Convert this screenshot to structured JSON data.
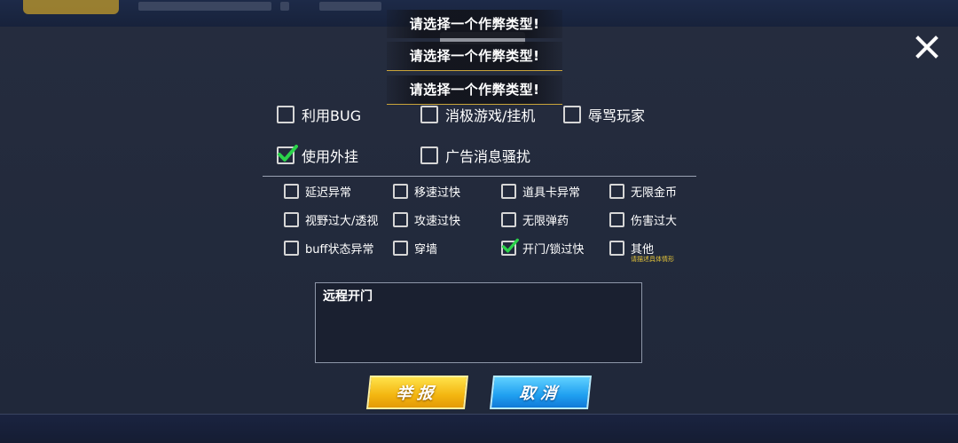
{
  "toasts": [
    "请选择一个作弊类型!",
    "请选择一个作弊类型!",
    "请选择一个作弊类型!"
  ],
  "main_options": [
    {
      "label": "利用BUG",
      "checked": false
    },
    {
      "label": "消极游戏/挂机",
      "checked": false
    },
    {
      "label": "辱骂玩家",
      "checked": false
    },
    {
      "label": "使用外挂",
      "checked": true
    },
    {
      "label": "广告消息骚扰",
      "checked": false
    }
  ],
  "sub_options": [
    {
      "label": "延迟异常",
      "checked": false
    },
    {
      "label": "移速过快",
      "checked": false
    },
    {
      "label": "道具卡异常",
      "checked": false
    },
    {
      "label": "无限金币",
      "checked": false
    },
    {
      "label": "视野过大/透视",
      "checked": false
    },
    {
      "label": "攻速过快",
      "checked": false
    },
    {
      "label": "无限弹药",
      "checked": false
    },
    {
      "label": "伤害过大",
      "checked": false
    },
    {
      "label": "buff状态异常",
      "checked": false
    },
    {
      "label": "穿墙",
      "checked": false
    },
    {
      "label": "开门/锁过快",
      "checked": true
    },
    {
      "label": "其他",
      "checked": false
    }
  ],
  "other_hint": "请描述具体情形",
  "description_value": "远程开门",
  "buttons": {
    "report": "举报",
    "cancel": "取消"
  },
  "colors": {
    "check": "#2bd34a",
    "report_button": "#f3b510",
    "cancel_button": "#1f9ff0",
    "hint": "#e4c53a"
  }
}
